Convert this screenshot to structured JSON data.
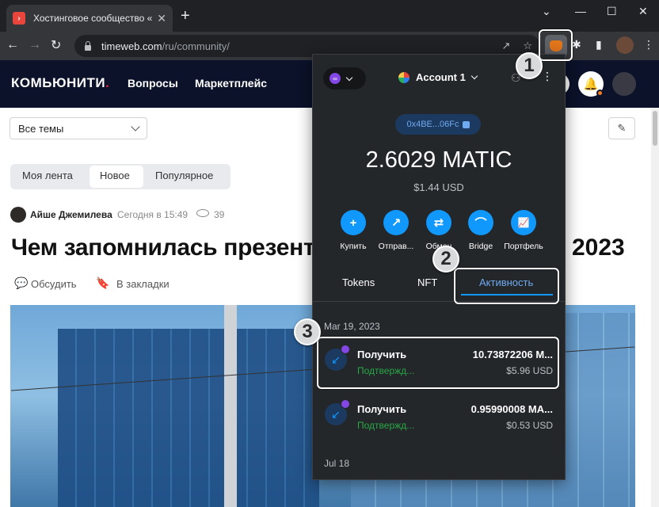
{
  "browser": {
    "tab_title": "Хостинговое сообщество «Time",
    "tab_close": "✕",
    "new_tab": "+",
    "window_controls": [
      "⌄",
      "—",
      "☐",
      "✕"
    ],
    "nav": {
      "back": "←",
      "forward": "→",
      "reload": "↻"
    },
    "url_host": "timeweb.com",
    "url_path": "/ru/community/",
    "omnibox_icons": [
      "↗",
      "☆"
    ],
    "toolbar_icons": {
      "extensions": "✱",
      "sidepanel": "▮",
      "menu": "⋮"
    }
  },
  "site": {
    "logo": "КОМЬЮНИТИ",
    "logo_dot": ".",
    "nav": [
      "Вопросы",
      "Маркетплейс"
    ],
    "bell": "🔔",
    "topics_select": "Все темы",
    "edit_icon": "✎",
    "feed_tabs": [
      "Моя лента",
      "Новое",
      "Популярное"
    ],
    "author": "Айше Джемилева",
    "date": "Сегодня в 15:49",
    "views": "39",
    "headline": "Чем запомнилась презент",
    "headline_end": "2023",
    "actions": [
      {
        "icon": "💬",
        "label": "Обсудить"
      },
      {
        "icon": "🔖",
        "label": "В закладки"
      }
    ]
  },
  "metamask": {
    "network_icon": "∞",
    "account": "Account 1",
    "globe": "⚇",
    "kebab": "⋮",
    "address": "0x4BE...06Fc",
    "balance": "2.6029 MATIC",
    "balance_usd": "$1.44 USD",
    "actions": [
      {
        "icon": "+",
        "label": "Купить"
      },
      {
        "icon": "↗",
        "label": "Отправ..."
      },
      {
        "icon": "⇄",
        "label": "Обмен"
      },
      {
        "icon": "⌒",
        "label": "Bridge"
      },
      {
        "icon": "📈",
        "label": "Портфель"
      }
    ],
    "tabs": [
      "Tokens",
      "NFT",
      "Активность"
    ],
    "activity": [
      {
        "date": "Mar 19, 2023",
        "type": "Получить",
        "status": "Подтвержд...",
        "amount": "10.73872206 M...",
        "usd": "$5.96 USD"
      },
      {
        "type": "Получить",
        "status": "Подтвержд...",
        "amount": "0.95990008 MA...",
        "usd": "$0.53 USD"
      }
    ],
    "date2": "Jul 18"
  },
  "annotations": [
    "1",
    "2",
    "3"
  ],
  "colors": {
    "accent": "#1098fc",
    "success": "#28a745",
    "site_header": "#0b1229",
    "popup_bg": "#24272a"
  }
}
